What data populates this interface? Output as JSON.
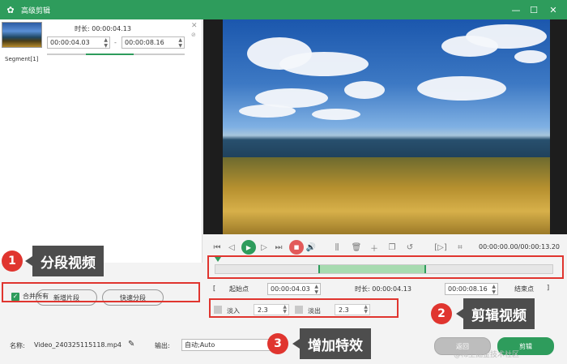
{
  "window": {
    "title": "高级剪辑"
  },
  "segment": {
    "duration_label": "时长:",
    "duration_value": "00:00:04.13",
    "start": "00:00:04.03",
    "end": "00:00:08.16",
    "dash": "-",
    "label": "Segment[1]",
    "progress": {
      "start_fraction": 0.28,
      "end_fraction": 0.63
    }
  },
  "left_buttons": {
    "new_segment": "新增片段",
    "quick_split": "快速分段",
    "merge_all": "合并所有"
  },
  "player": {
    "timecode": "00:00:00.00/00:00:13.20"
  },
  "trim": {
    "start_label": "起始点",
    "start_value": "00:00:04.03",
    "duration_label": "时长:",
    "duration_value": "00:00:04.13",
    "end_value": "00:00:08.16",
    "end_label": "结束点",
    "selection": {
      "start_fraction": 0.305,
      "end_fraction": 0.625
    }
  },
  "effects": {
    "fade_in_label": "淡入",
    "fade_in_value": "2.3",
    "fade_out_label": "淡出",
    "fade_out_value": "2.3"
  },
  "bottom": {
    "name_label": "名称:",
    "name_value": "Video_240325115118.mp4",
    "output_label": "输出:",
    "output_value": "自动;Auto",
    "back_button": "返回",
    "edit_button": "剪辑"
  },
  "annotations": {
    "one": {
      "number": "1",
      "text": "分段视频"
    },
    "two": {
      "number": "2",
      "text": "剪辑视频"
    },
    "three": {
      "number": "3",
      "text": "增加特效"
    }
  },
  "watermark": "@稀土掘金技术社区",
  "colors": {
    "accent": "#2e9c5c",
    "annotation_red": "#e0352f",
    "callout_bg": "#4d4d4d"
  }
}
